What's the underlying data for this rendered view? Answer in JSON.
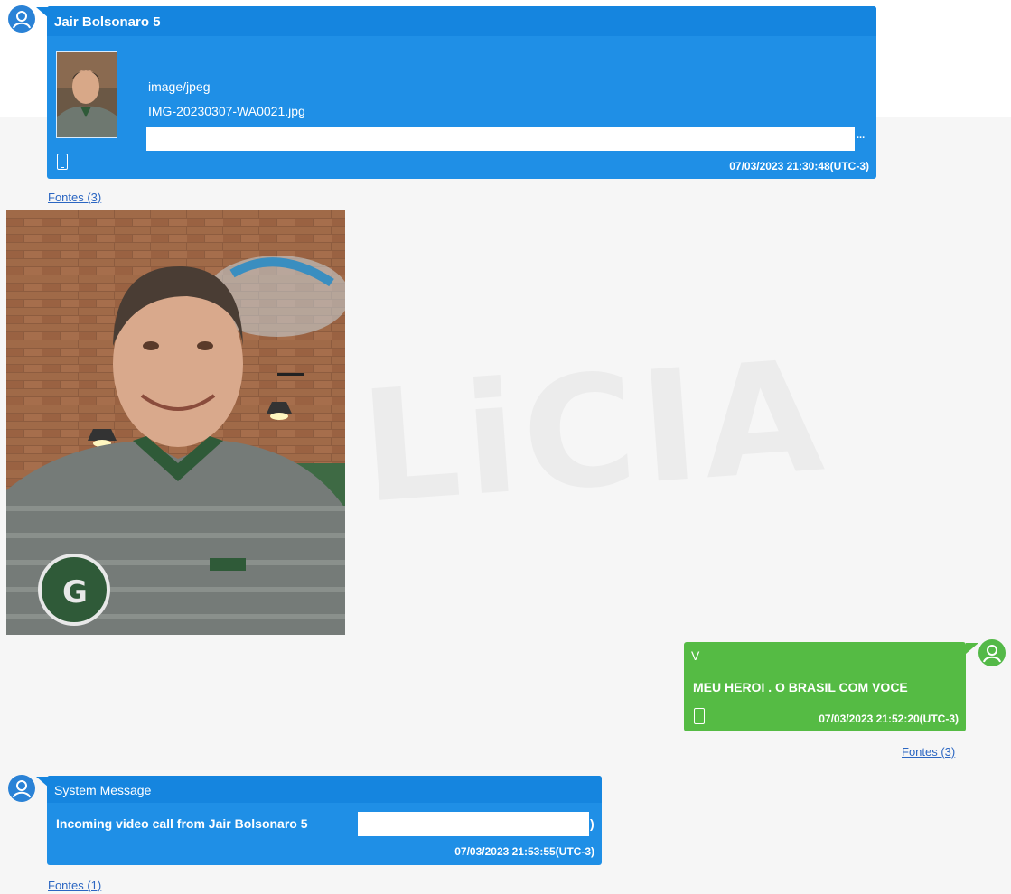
{
  "messages": [
    {
      "sender": "Jair Bolsonaro 5",
      "attachment": {
        "mime": "image/jpeg",
        "filename": "IMG-20230307-WA0021.jpg",
        "more": "..."
      },
      "timestamp": "07/03/2023 21:30:48(UTC-3)",
      "sources": "Fontes (3)",
      "device_icon": "phone-icon"
    },
    {
      "sender": "V",
      "text": "MEU HEROI .  O  BRASIL COM VOCE",
      "timestamp": "07/03/2023 21:52:20(UTC-3)",
      "sources": "Fontes (3)",
      "device_icon": "phone-icon"
    },
    {
      "sender": "System Message",
      "text_prefix": "Incoming video call from Jair Bolsonaro 5",
      "text_suffix": ")",
      "timestamp": "07/03/2023 21:53:55(UTC-3)",
      "sources": "Fontes (1)"
    }
  ],
  "watermark": "LiCIA",
  "colors": {
    "incoming_bubble": "#1f8fe6",
    "outgoing_bubble": "#55bb44",
    "link": "#2b66c2"
  }
}
